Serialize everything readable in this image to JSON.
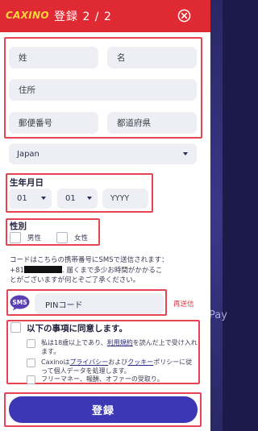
{
  "header": {
    "logo_main": "CAXINO",
    "title": "登録 2 / 2"
  },
  "form": {
    "last_name": "姓",
    "first_name": "名",
    "address": "住所",
    "postal_code": "郵便番号",
    "prefecture": "都道府県",
    "country": "Japan",
    "birth_label": "生年月日",
    "birth_day": "01",
    "birth_month": "01",
    "birth_year": "YYYY",
    "gender_label": "性別",
    "gender_male": "男性",
    "gender_female": "女性"
  },
  "sms": {
    "note_line1": "コードはこちらの携帯番号にSMSで送信されます：",
    "note_prefix": "+81",
    "note_rest": ". 届くまで多少お時間がかかるこ",
    "note_line3": "とがございますが何とぞご了承ください。",
    "icon_label": "SMS",
    "pin_placeholder": "PINコード",
    "resend": "再送信"
  },
  "agree": {
    "title": "以下の事項に同意します。",
    "item1_a": "私は18歳以上であり、",
    "item1_link": "利用規約",
    "item1_b": "を読んだ上で受け入れます。",
    "item2_a": "Caxinoは",
    "item2_link1": "プライバシー",
    "item2_mid": "および",
    "item2_link2": "クッキー",
    "item2_b": "ポリシーに従って個人データを処理します。",
    "item3": "フリーマネー、報酬、オファーの受取り。"
  },
  "submit_label": "登録",
  "side_text": "Pay",
  "colors": {
    "header_red": "#e02a33",
    "logo_yellow": "#ffd43b",
    "submit_purple": "#3c38b5",
    "highlight_red": "#e64452"
  }
}
